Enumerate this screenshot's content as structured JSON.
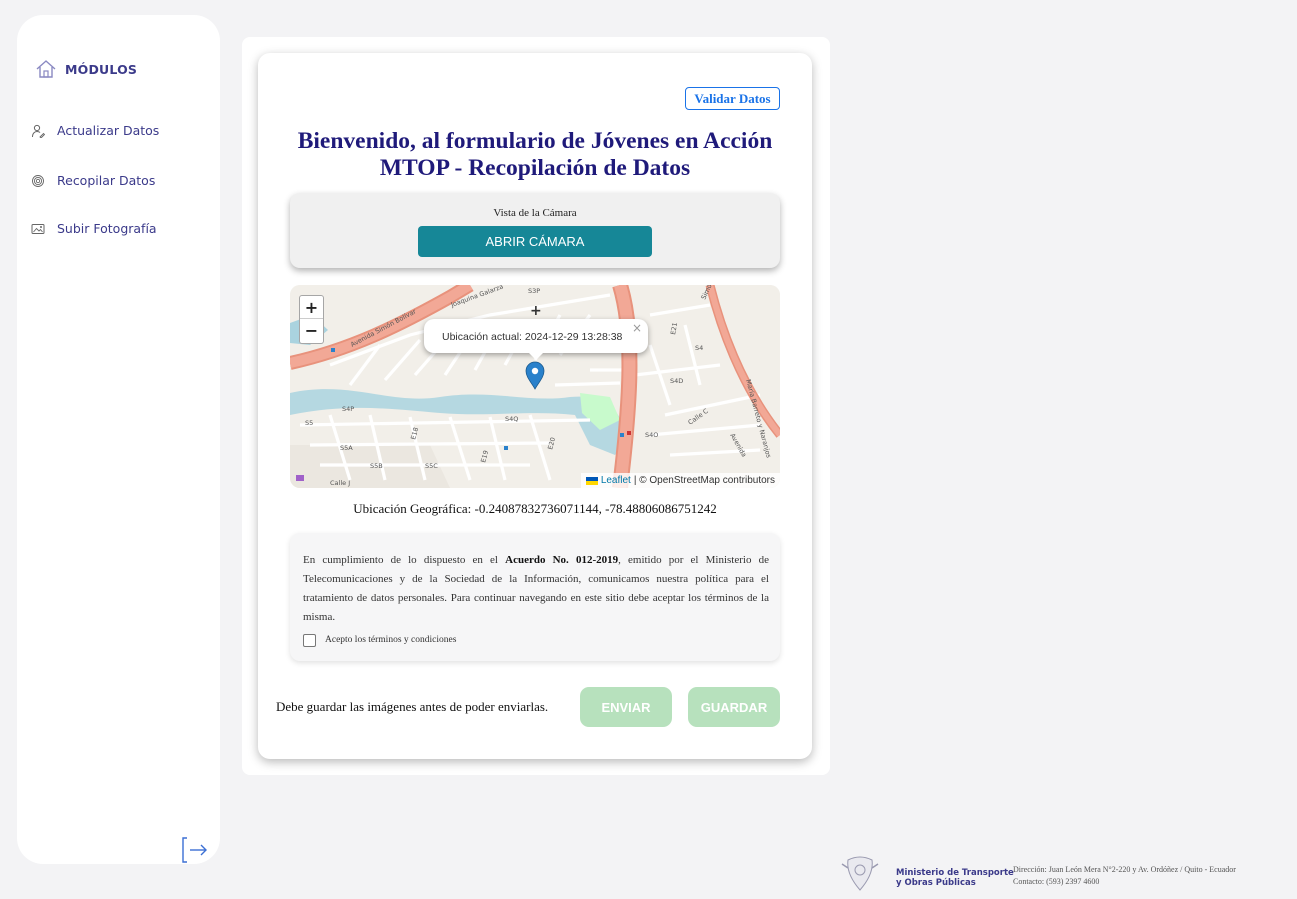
{
  "sidebar": {
    "header": {
      "label": "MÓDULOS",
      "icon": "home-icon"
    },
    "items": [
      {
        "label": "Actualizar Datos",
        "icon": "user-edit-icon"
      },
      {
        "label": "Recopilar Datos",
        "icon": "fingerprint-icon"
      },
      {
        "label": "Subir Fotografía",
        "icon": "image-upload-icon"
      }
    ],
    "logout_icon": "logout-icon"
  },
  "main": {
    "validate_button": "Validar Datos",
    "title_line1": "Bienvenido, al formulario de Jóvenes en Acción",
    "title_line2": "MTOP - Recopilación de Datos",
    "camera": {
      "label": "Vista de la Cámara",
      "button": "ABRIR CÁMARA"
    },
    "map": {
      "zoom_in": "+",
      "zoom_out": "−",
      "popup_text": "Ubicación actual: 2024-12-29 13:28:38",
      "popup_close": "×",
      "attribution_link": "Leaflet",
      "attribution_text": "| © OpenStreetMap contributors",
      "street_labels": [
        "Avenida Simón Bolívar",
        "Joaquina Galarza",
        "Simón Bolívar",
        "María Barreto y Naranjos",
        "Avenida",
        "S3P",
        "S4",
        "S4D",
        "S4Q",
        "S4P",
        "S5",
        "S5A",
        "S5B",
        "S5C",
        "S4O",
        "E21",
        "E20",
        "E19",
        "E18",
        "Calle C",
        "Calle J"
      ]
    },
    "geo_location": "Ubicación Geográfica: -0.24087832736071144, -78.48806086751242",
    "terms": {
      "text_before": "En cumplimiento de lo dispuesto en el ",
      "text_bold": "Acuerdo No. 012-2019",
      "text_after": ", emitido por el Ministerio de Telecomunicaciones y de la Sociedad de la Información, comunicamos nuestra política para el tratamiento de datos personales. Para continuar navegando en este sitio debe aceptar los términos de la misma.",
      "checkbox_label": "Acepto los términos y condiciones",
      "checked": false
    },
    "save_message": "Debe guardar las imágenes antes de poder enviarlas.",
    "send_button": "ENVIAR",
    "save_button": "GUARDAR"
  },
  "footer": {
    "ministry_line1": "Ministerio de Transporte",
    "ministry_line2": "y Obras Públicas",
    "address": "Dirección: Juan León Mera N°2-220 y Av. Ordóñez / Quito - Ecuador",
    "contact": "Contacto: (593) 2397 4600"
  },
  "colors": {
    "brand_indigo": "#3b3a8a",
    "title_navy": "#1f1a7a",
    "camera_button": "#168797",
    "disabled_green": "#b7e1bd",
    "link_blue": "#1a73e8",
    "map_marker": "#2a81cb"
  }
}
